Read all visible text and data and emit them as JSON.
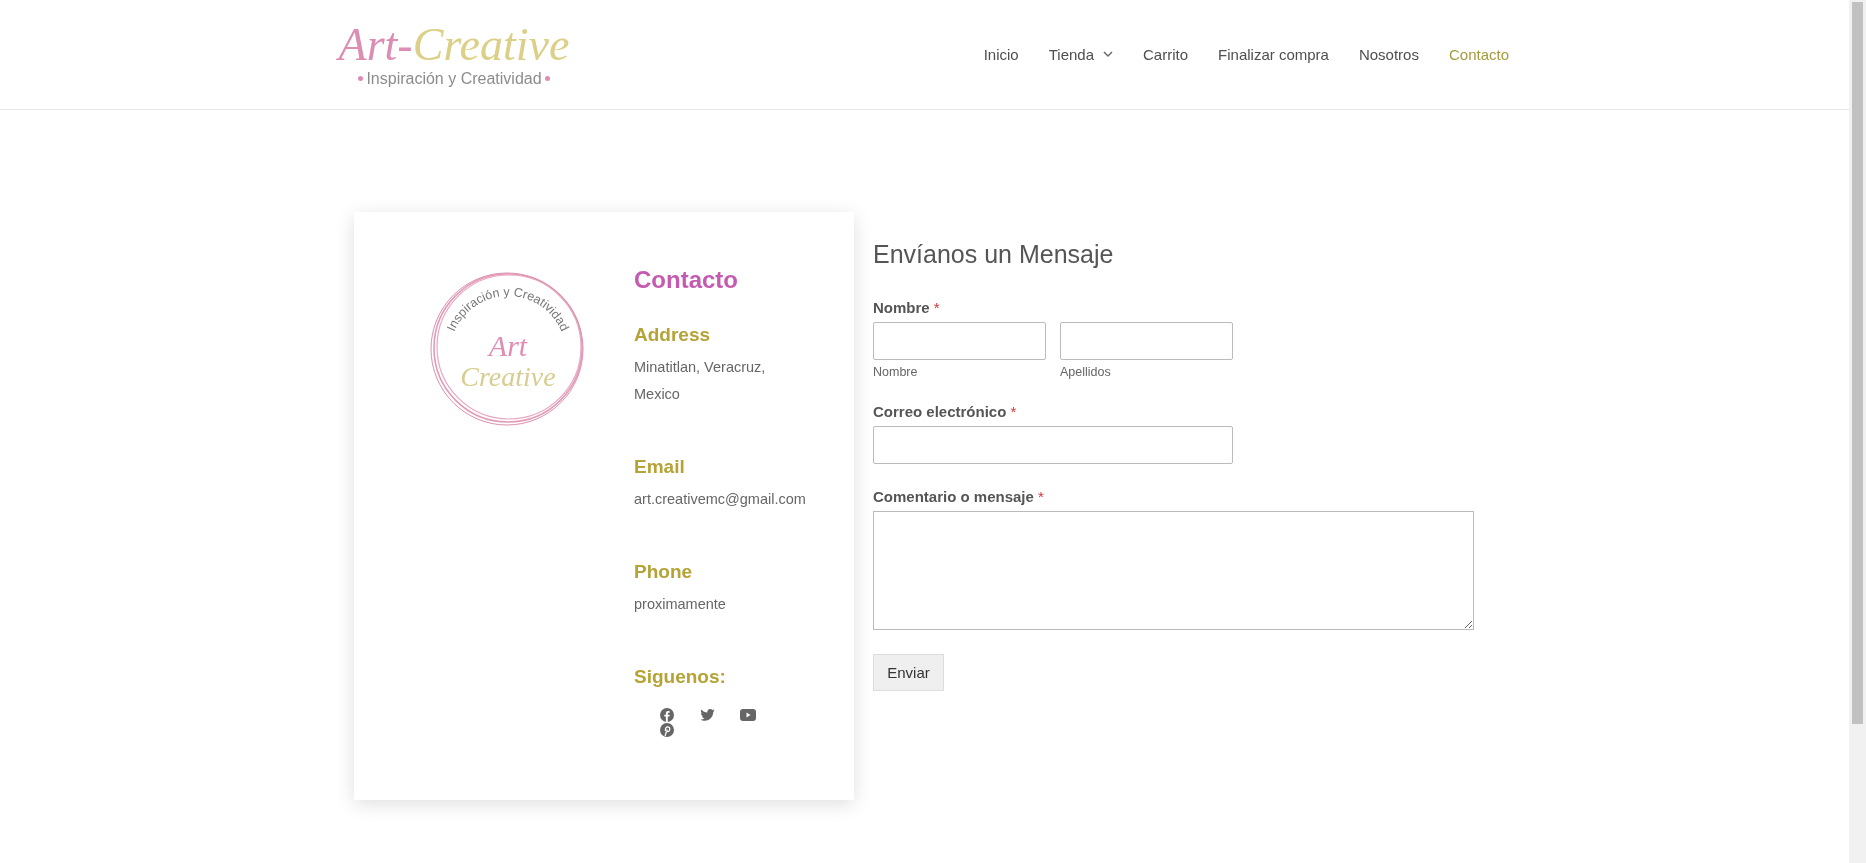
{
  "header": {
    "logo": {
      "title_left": "Art-",
      "title_right": "Creative",
      "tagline": "Inspiración y Creatividad"
    },
    "nav": [
      {
        "label": "Inicio",
        "selected": false,
        "dropdown": false
      },
      {
        "label": "Tienda",
        "selected": false,
        "dropdown": true
      },
      {
        "label": "Carrito",
        "selected": false,
        "dropdown": false
      },
      {
        "label": "Finalizar compra",
        "selected": false,
        "dropdown": false
      },
      {
        "label": "Nosotros",
        "selected": false,
        "dropdown": false
      },
      {
        "label": "Contacto",
        "selected": true,
        "dropdown": false
      }
    ]
  },
  "contact_card": {
    "badge": {
      "arc_text": "Inspiración y Creatividad",
      "line_1": "Art",
      "line_2": "Creative"
    },
    "heading": "Contacto",
    "sections": [
      {
        "heading": "Address",
        "text": "Minatitlan, Veracruz, Mexico"
      },
      {
        "heading": "Email",
        "text": "art.creativemc@gmail.com"
      },
      {
        "heading": "Phone",
        "text": "proximamente"
      }
    ],
    "social_heading": "Siguenos:",
    "social": [
      {
        "kind": "facebook"
      },
      {
        "kind": "twitter"
      },
      {
        "kind": "youtube"
      },
      {
        "kind": "pinterest"
      }
    ]
  },
  "form": {
    "title": "Envíanos un Mensaje",
    "fields": [
      {
        "kind": "name",
        "label": "Nombre",
        "required": true,
        "marker": "*",
        "sublabels": [
          "Nombre",
          "Apellidos"
        ]
      },
      {
        "kind": "email",
        "label": "Correo electrónico",
        "required": true,
        "marker": "*"
      },
      {
        "kind": "textarea",
        "label": "Comentario o mensaje",
        "required": true,
        "marker": "*"
      }
    ],
    "submit": "Enviar"
  }
}
